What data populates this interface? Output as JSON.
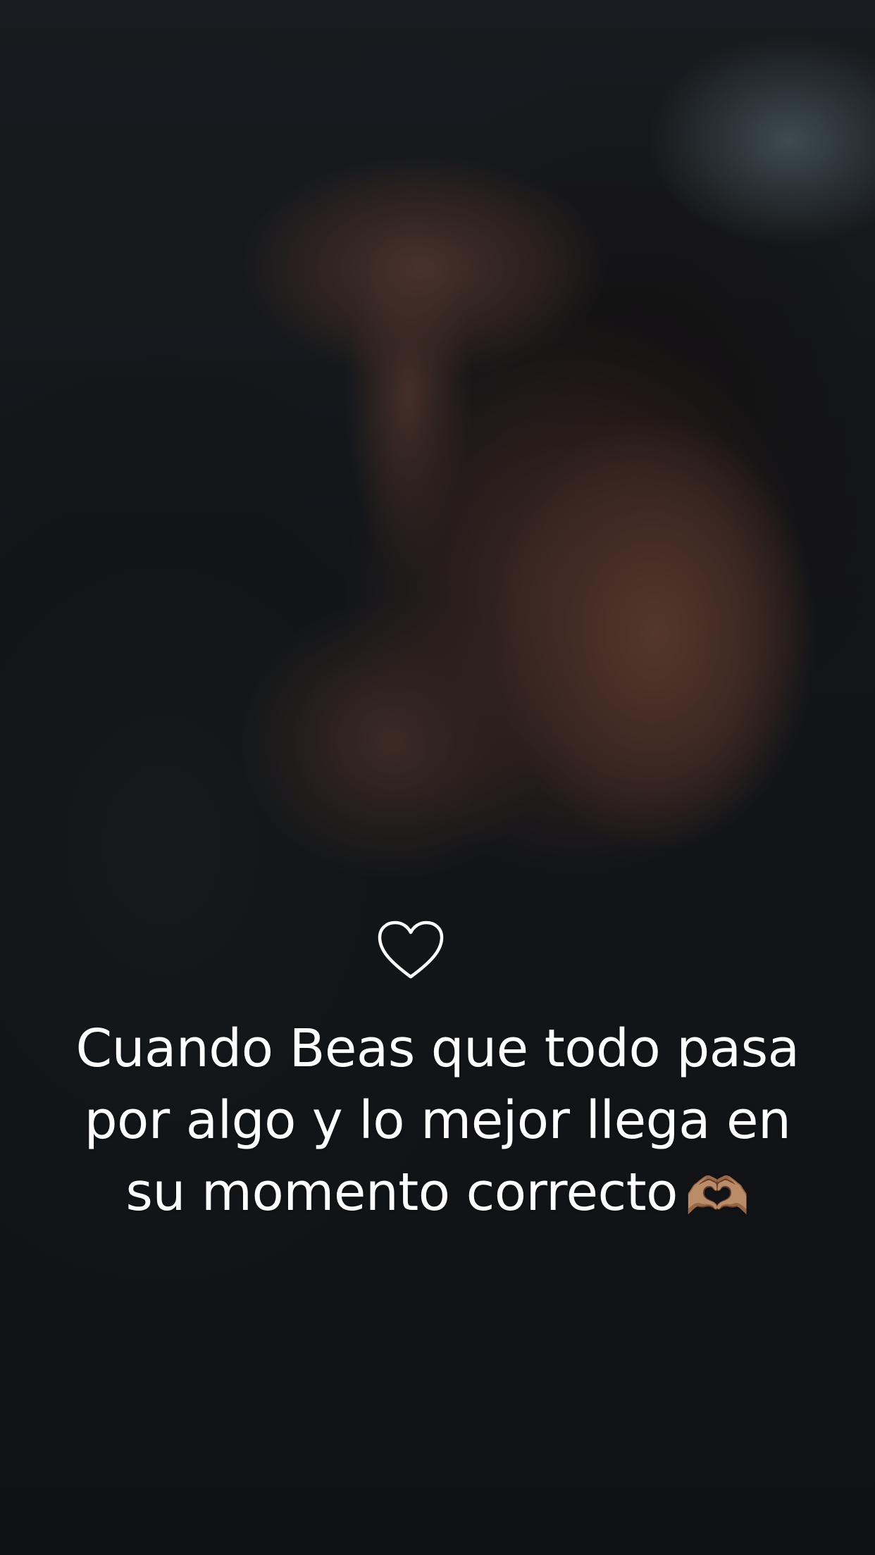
{
  "caption": {
    "text": "Cuando Beas que todo pasa por algo y lo mejor llega en su momento correcto",
    "emoji": "🫶🏽"
  },
  "icons": {
    "heart": "heart-outline-icon",
    "hands": "heart-hands-icon"
  },
  "colors": {
    "caption_text": "#ffffff",
    "heart_stroke": "#ffffff"
  }
}
